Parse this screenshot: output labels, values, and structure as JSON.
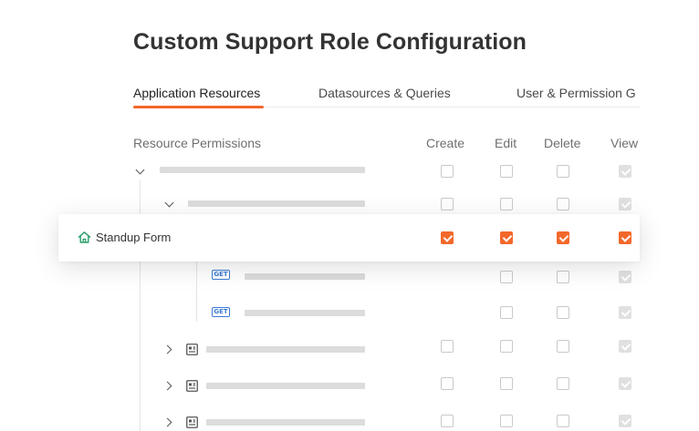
{
  "page_title": "Custom Support Role Configuration",
  "tabs": [
    {
      "label": "Application Resources",
      "active": true
    },
    {
      "label": "Datasources & Queries",
      "active": false
    },
    {
      "label": "User & Permission G",
      "active": false
    }
  ],
  "table": {
    "resource_header": "Resource Permissions",
    "columns": [
      "Create",
      "Edit",
      "Delete",
      "View"
    ],
    "highlighted_row": {
      "label": "Standup Form",
      "icon": "home-icon",
      "create": true,
      "edit": true,
      "delete": true,
      "view": true
    },
    "method_badge": "GET"
  },
  "colors": {
    "accent": "#f2682a",
    "get_badge": "#3b7bd6",
    "home_icon": "#2a9d6a"
  }
}
